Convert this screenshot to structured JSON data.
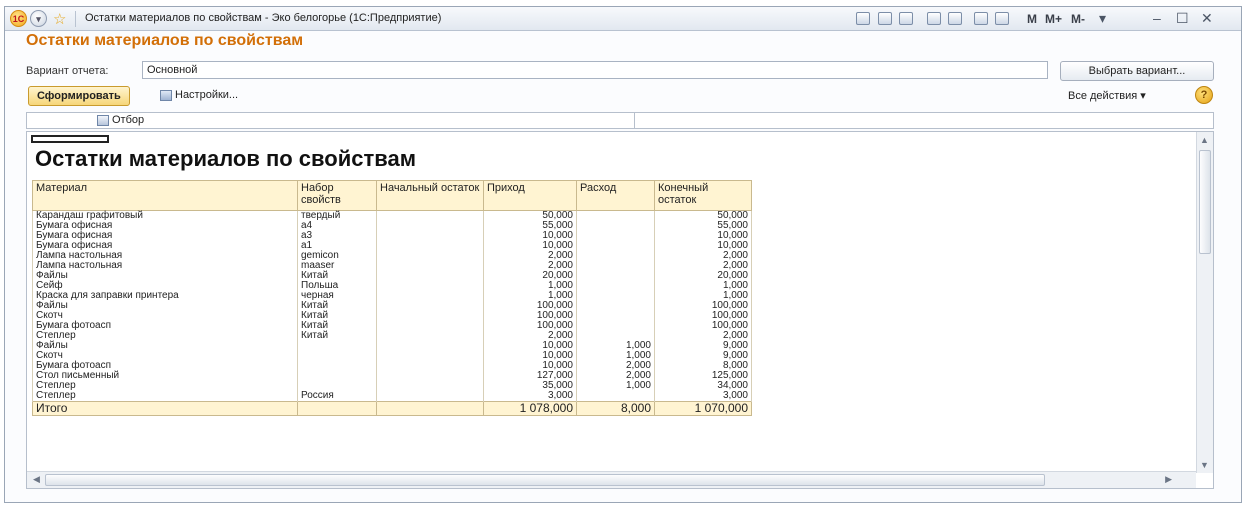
{
  "window": {
    "title": "Остатки материалов по свойствам - Эко белогорье  (1С:Предприятие)",
    "logo": "1C",
    "memory_buttons": [
      "M",
      "M+",
      "M-"
    ],
    "toolbar_icons": [
      "save-icon",
      "print-icon",
      "preview-icon",
      "favorites-add-icon",
      "favorites-icon",
      "calculator-icon",
      "calendar-icon"
    ]
  },
  "header": {
    "title": "Остатки материалов по свойствам",
    "variant_label": "Вариант отчета:",
    "variant_value": "Основной",
    "choose_variant": "Выбрать вариант..."
  },
  "commands": {
    "generate": "Сформировать",
    "settings": "Настройки...",
    "all_actions": "Все действия ▾",
    "help": "?"
  },
  "filter": {
    "label": "Отбор"
  },
  "report": {
    "title": "Остатки материалов по свойствам",
    "columns": [
      "Материал",
      "Набор свойств",
      "Начальный остаток",
      "Приход",
      "Расход",
      "Конечный остаток"
    ],
    "rows": [
      [
        "Карандаш графитовый",
        "твердый",
        "",
        "50,000",
        "",
        "50,000"
      ],
      [
        "Бумага офисная",
        "а4",
        "",
        "55,000",
        "",
        "55,000"
      ],
      [
        "Бумага офисная",
        "а3",
        "",
        "10,000",
        "",
        "10,000"
      ],
      [
        "Бумага офисная",
        "а1",
        "",
        "10,000",
        "",
        "10,000"
      ],
      [
        "Лампа настольная",
        "gemicon",
        "",
        "2,000",
        "",
        "2,000"
      ],
      [
        "Лампа настольная",
        "maaser",
        "",
        "2,000",
        "",
        "2,000"
      ],
      [
        "Файлы",
        "Китай",
        "",
        "20,000",
        "",
        "20,000"
      ],
      [
        "Сейф",
        "Польша",
        "",
        "1,000",
        "",
        "1,000"
      ],
      [
        "Краска для заправки принтера",
        "черная",
        "",
        "1,000",
        "",
        "1,000"
      ],
      [
        "Файлы",
        "Китай",
        "",
        "100,000",
        "",
        "100,000"
      ],
      [
        "Скотч",
        "Китай",
        "",
        "100,000",
        "",
        "100,000"
      ],
      [
        "Бумага фотоасп",
        "Китай",
        "",
        "100,000",
        "",
        "100,000"
      ],
      [
        "Степлер",
        "Китай",
        "",
        "2,000",
        "",
        "2,000"
      ],
      [
        "Файлы",
        "",
        "",
        "10,000",
        "1,000",
        "9,000"
      ],
      [
        "Скотч",
        "",
        "",
        "10,000",
        "1,000",
        "9,000"
      ],
      [
        "Бумага фотоасп",
        "",
        "",
        "10,000",
        "2,000",
        "8,000"
      ],
      [
        "Стол письменный",
        "",
        "",
        "127,000",
        "2,000",
        "125,000"
      ],
      [
        "Степлер",
        "",
        "",
        "35,000",
        "1,000",
        "34,000"
      ],
      [
        "Степлер",
        "Россия",
        "",
        "3,000",
        "",
        "3,000"
      ]
    ],
    "total": [
      "Итого",
      "",
      "",
      "1 078,000",
      "8,000",
      "1 070,000"
    ]
  }
}
